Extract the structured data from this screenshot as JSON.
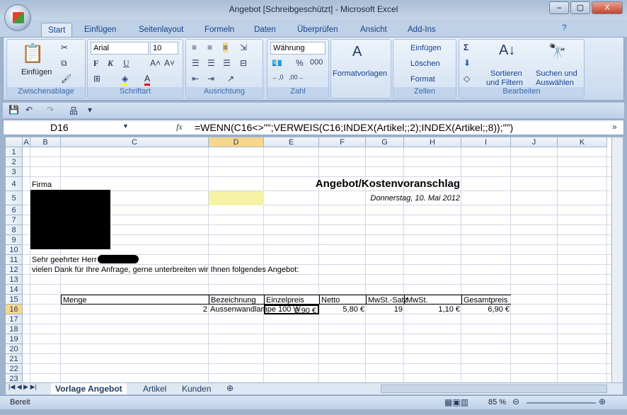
{
  "window": {
    "title": "Angebot  [Schreibgeschützt] - Microsoft Excel",
    "min": "–",
    "max": "▢",
    "close": "X"
  },
  "tabs": [
    "Start",
    "Einfügen",
    "Seitenlayout",
    "Formeln",
    "Daten",
    "Überprüfen",
    "Ansicht",
    "Add-Ins"
  ],
  "ribbon": {
    "clipboard": {
      "label": "Zwischenablage",
      "paste": "Einfügen"
    },
    "font": {
      "label": "Schriftart",
      "name": "Arial",
      "size": "10",
      "bold": "F",
      "italic": "K",
      "underline": "U"
    },
    "align": {
      "label": "Ausrichtung"
    },
    "number": {
      "label": "Zahl",
      "format": "Währung",
      "percent": "%",
      "thousands": "000"
    },
    "styles": {
      "label": "Formatvorlagen"
    },
    "cells": {
      "label": "Zellen",
      "insert": "Einfügen",
      "delete": "Löschen",
      "format": "Format"
    },
    "edit": {
      "label": "Bearbeiten",
      "sum": "Σ",
      "sort1": "Sortieren",
      "sort2": "und Filtern",
      "find1": "Suchen und",
      "find2": "Auswählen"
    }
  },
  "formula_bar": {
    "name_box": "D16",
    "fx": "fx",
    "formula": "=WENN(C16<>\"\";VERWEIS(C16;INDEX(Artikel;;2);INDEX(Artikel;;8));\"\")"
  },
  "columns": [
    "A",
    "B",
    "C",
    "D",
    "E",
    "F",
    "G",
    "H",
    "I",
    "J",
    "K"
  ],
  "rows": [
    "1",
    "2",
    "3",
    "4",
    "5",
    "6",
    "7",
    "8",
    "9",
    "10",
    "11",
    "12",
    "13",
    "14",
    "15",
    "16",
    "17",
    "18",
    "19",
    "20",
    "21",
    "22",
    "23"
  ],
  "cells": {
    "firma": "Firma",
    "heading": "Angebot/Kostenvoranschlag",
    "date": "Donnerstag, 10. Mai 2012",
    "salutation": "Sehr geehrter Herr",
    "intro": "vielen Dank für Ihre Anfrage, gerne unterbreiten wir Ihnen folgendes Angebot:",
    "headers": [
      "Menge",
      "Bezeichnung",
      "Einzelpreis",
      "Netto",
      "MwSt.-Satz",
      "MwSt.",
      "Gesamtpreis"
    ],
    "row16": [
      "2",
      "Aussenwandlampe 100 W",
      "2,90 €",
      "5,80 €",
      "19",
      "1,10 €",
      "6,90 €"
    ]
  },
  "sheets": [
    "Vorlage Angebot",
    "Artikel",
    "Kunden"
  ],
  "status": {
    "ready": "Bereit",
    "zoom": "85 %"
  }
}
